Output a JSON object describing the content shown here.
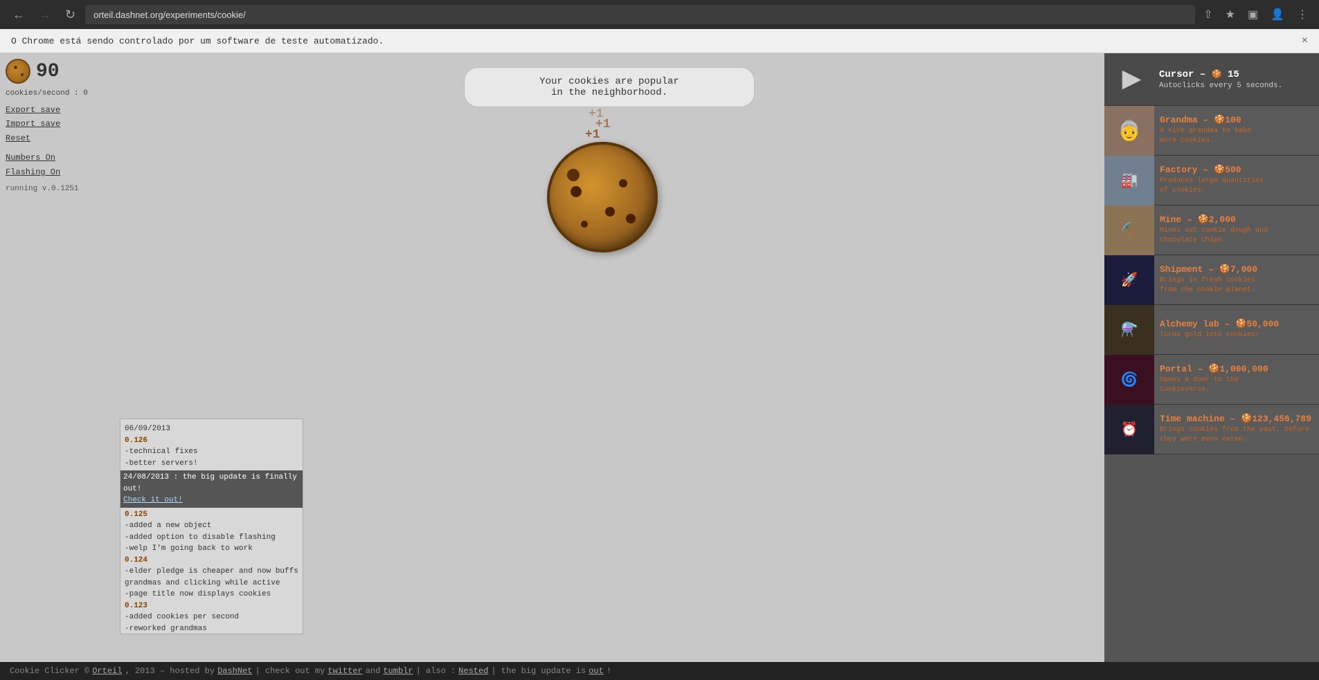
{
  "browser": {
    "url": "orteil.dashnet.org/experiments/cookie/",
    "back_disabled": false,
    "forward_disabled": true
  },
  "automation_banner": {
    "text": "O Chrome está sendo controlado por um software de teste automatizado.",
    "close_label": "×"
  },
  "left_panel": {
    "cookie_count": "90",
    "cookies_per_second_label": "cookies/second : 0",
    "export_save_label": "Export save",
    "import_save_label": "Import save",
    "reset_label": "Reset",
    "numbers_on_label": "Numbers On",
    "flashing_on_label": "Flashing On",
    "version_label": "running v.0.1251"
  },
  "news_ticker": {
    "line1": "Your cookies are popular",
    "line2": "in the neighborhood."
  },
  "click_particles": [
    "+1",
    "+1",
    "+1"
  ],
  "shop": {
    "cursor": {
      "title": "Cursor",
      "cost_icon": "🍪",
      "cost": "15",
      "description": "Autoclicks every 5 seconds."
    },
    "items": [
      {
        "name": "Grandma",
        "cost_icon": "🍪",
        "cost": "100",
        "description": "A nice grandma to bake more cookies.",
        "emoji": "👵"
      },
      {
        "name": "Factory",
        "cost_icon": "🍪",
        "cost": "500",
        "description": "Produces large quantities of cookies.",
        "emoji": "🏭"
      },
      {
        "name": "Mine",
        "cost_icon": "🍪",
        "cost": "2,000",
        "description": "Mines out cookie dough and chocolate chips.",
        "emoji": "⛏️"
      },
      {
        "name": "Shipment",
        "cost_icon": "🍪",
        "cost": "7,000",
        "description": "Brings in fresh cookies from the cookie planet.",
        "emoji": "🚀"
      },
      {
        "name": "Alchemy lab",
        "cost_icon": "🍪",
        "cost": "50,000",
        "description": "Turns gold into cookies!",
        "emoji": "⚗️"
      },
      {
        "name": "Portal",
        "cost_icon": "🍪",
        "cost": "1,000,000",
        "description": "Opens a door to the Cookieverse.",
        "emoji": "🌀"
      },
      {
        "name": "Time machine",
        "cost_icon": "🍪",
        "cost": "123,456,789",
        "description": "Brings cookies from the past, before they were even eaten.",
        "emoji": "⏰"
      }
    ]
  },
  "changelog": [
    {
      "type": "date",
      "text": "06/09/2013"
    },
    {
      "type": "version",
      "text": "0.126"
    },
    {
      "type": "normal",
      "text": "-technical fixes"
    },
    {
      "type": "normal",
      "text": "-better servers!"
    },
    {
      "type": "highlight_date",
      "text": "24/08/2013 : the big update is finally out!"
    },
    {
      "type": "highlight_link",
      "text": "Check it out!"
    },
    {
      "type": "version",
      "text": "0.125"
    },
    {
      "type": "normal",
      "text": "-added a new object"
    },
    {
      "type": "normal",
      "text": "-added option to disable flashing"
    },
    {
      "type": "normal",
      "text": "-welp I'm going back to work"
    },
    {
      "type": "version",
      "text": "0.124"
    },
    {
      "type": "normal",
      "text": "-elder pledge is cheaper and now buffs grandmas and clicking while active"
    },
    {
      "type": "normal",
      "text": "-page title now displays cookies"
    },
    {
      "type": "version",
      "text": "0.123"
    },
    {
      "type": "normal",
      "text": "-added cookies per second"
    },
    {
      "type": "normal",
      "text": "-reworked grandmas"
    }
  ],
  "footer": {
    "copyright": "Cookie Clicker © ",
    "orteil_link": "Orteil",
    "year": ", 2013 – hosted by ",
    "dashnet_link": "DashNet",
    "sep1": " | check out my ",
    "twitter_link": "twitter",
    "and": " and ",
    "tumblr_link": "tumblr",
    "sep2": " | also : ",
    "nested_link": "Nested",
    "sep3": " | the big update is ",
    "out_link": "out",
    "end": "!"
  }
}
